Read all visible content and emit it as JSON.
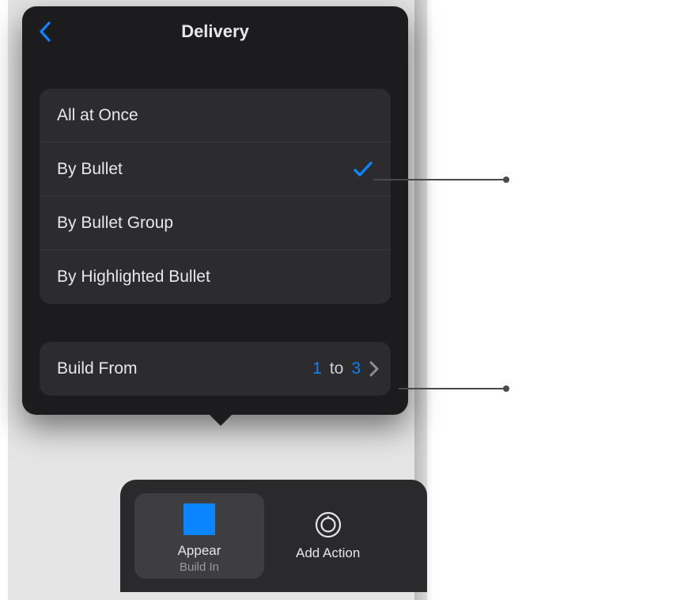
{
  "popover": {
    "title": "Delivery"
  },
  "options": [
    {
      "label": "All at Once",
      "selected": false
    },
    {
      "label": "By Bullet",
      "selected": true
    },
    {
      "label": "By Bullet Group",
      "selected": false
    },
    {
      "label": "By Highlighted Bullet",
      "selected": false
    }
  ],
  "buildFrom": {
    "label": "Build From",
    "from": "1",
    "to_word": "to",
    "to": "3"
  },
  "effect": {
    "title": "Appear",
    "subtitle": "Build In"
  },
  "addAction": {
    "label": "Add Action"
  },
  "colors": {
    "accent": "#0a84ff"
  }
}
